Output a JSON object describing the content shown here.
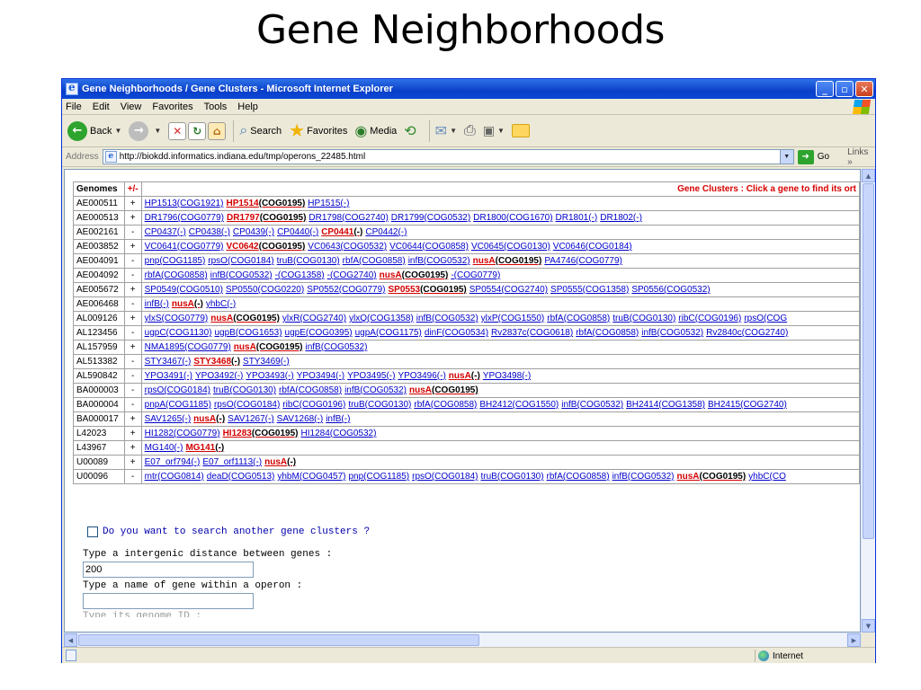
{
  "slide": {
    "title": "Gene Neighborhoods"
  },
  "browser": {
    "title": "Gene Neighborhoods / Gene Clusters - Microsoft Internet Explorer",
    "menu": [
      "File",
      "Edit",
      "View",
      "Favorites",
      "Tools",
      "Help"
    ],
    "toolbar": {
      "back": "Back",
      "search": "Search",
      "favorites": "Favorites",
      "media": "Media"
    },
    "address_label": "Address",
    "url": "http://biokdd.informatics.indiana.edu/tmp/operons_22485.html",
    "go": "Go",
    "links": "Links",
    "status_zone": "Internet"
  },
  "table": {
    "col_genomes": "Genomes",
    "col_sign": "+/-",
    "header_right": "Gene Clusters : Click a gene to find its ort",
    "rows": [
      {
        "id": "AE000511",
        "sign": "+",
        "genes": [
          {
            "t": "HP1513(COG1921)"
          },
          {
            "t": "HP1514",
            "c": "(COG0195)",
            "hit": true
          },
          {
            "t": "HP1515(-)"
          }
        ]
      },
      {
        "id": "AE000513",
        "sign": "+",
        "genes": [
          {
            "t": "DR1796(COG0779)"
          },
          {
            "t": "DR1797",
            "c": "(COG0195)",
            "hit": true
          },
          {
            "t": "DR1798(COG2740)"
          },
          {
            "t": "DR1799(COG0532)"
          },
          {
            "t": "DR1800(COG1670)"
          },
          {
            "t": "DR1801(-)"
          },
          {
            "t": "DR1802(-)"
          }
        ]
      },
      {
        "id": "AE002161",
        "sign": "-",
        "genes": [
          {
            "t": "CP0437(-)"
          },
          {
            "t": "CP0438(-)"
          },
          {
            "t": "CP0439(-)"
          },
          {
            "t": "CP0440(-)"
          },
          {
            "t": "CP0441",
            "c": "(-)",
            "hit": true
          },
          {
            "t": "CP0442(-)"
          }
        ]
      },
      {
        "id": "AE003852",
        "sign": "+",
        "genes": [
          {
            "t": "VC0641(COG0779)"
          },
          {
            "t": "VC0642",
            "c": "(COG0195)",
            "hit": true
          },
          {
            "t": "VC0643(COG0532)"
          },
          {
            "t": "VC0644(COG0858)"
          },
          {
            "t": "VC0645(COG0130)"
          },
          {
            "t": "VC0646(COG0184)"
          }
        ]
      },
      {
        "id": "AE004091",
        "sign": "-",
        "genes": [
          {
            "t": "pnp(COG1185)"
          },
          {
            "t": "rpsO(COG0184)"
          },
          {
            "t": "truB(COG0130)"
          },
          {
            "t": "rbfA(COG0858)"
          },
          {
            "t": "infB(COG0532)"
          },
          {
            "t": "nusA",
            "c": "(COG0195)",
            "hit": true
          },
          {
            "t": "PA4746(COG0779)"
          }
        ]
      },
      {
        "id": "AE004092",
        "sign": "-",
        "genes": [
          {
            "t": "rbfA(COG0858)"
          },
          {
            "t": "infB(COG0532)"
          },
          {
            "t": "-(COG1358)"
          },
          {
            "t": "-(COG2740)"
          },
          {
            "t": "nusA",
            "c": "(COG0195)",
            "hit": true
          },
          {
            "t": "-(COG0779)"
          }
        ]
      },
      {
        "id": "AE005672",
        "sign": "+",
        "genes": [
          {
            "t": "SP0549(COG0510)"
          },
          {
            "t": "SP0550(COG0220)"
          },
          {
            "t": "SP0552(COG0779)"
          },
          {
            "t": "SP0553",
            "c": "(COG0195)",
            "hit": true
          },
          {
            "t": "SP0554(COG2740)"
          },
          {
            "t": "SP0555(COG1358)"
          },
          {
            "t": "SP0556(COG0532)"
          }
        ]
      },
      {
        "id": "AE006468",
        "sign": "-",
        "genes": [
          {
            "t": "infB(-)"
          },
          {
            "t": "nusA",
            "c": "(-)",
            "hit": true
          },
          {
            "t": "yhbC(-)"
          }
        ]
      },
      {
        "id": "AL009126",
        "sign": "+",
        "genes": [
          {
            "t": "ylxS(COG0779)"
          },
          {
            "t": "nusA",
            "c": "(COG0195)",
            "hit": true
          },
          {
            "t": "ylxR(COG2740)"
          },
          {
            "t": "ylxQ(COG1358)"
          },
          {
            "t": "infB(COG0532)"
          },
          {
            "t": "ylxP(COG1550)"
          },
          {
            "t": "rbfA(COG0858)"
          },
          {
            "t": "truB(COG0130)"
          },
          {
            "t": "ribC(COG0196)"
          },
          {
            "t": "rpsO(COG"
          }
        ]
      },
      {
        "id": "AL123456",
        "sign": "-",
        "genes": [
          {
            "t": "ugpC(COG1130)"
          },
          {
            "t": "ugpB(COG1653)"
          },
          {
            "t": "ugpE(COG0395)"
          },
          {
            "t": "ugpA(COG1175)"
          },
          {
            "t": "dinF(COG0534)"
          },
          {
            "t": "Rv2837c(COG0618)"
          },
          {
            "t": "rbfA(COG0858)"
          },
          {
            "t": "infB(COG0532)"
          },
          {
            "t": "Rv2840c(COG2740)"
          }
        ]
      },
      {
        "id": "AL157959",
        "sign": "+",
        "genes": [
          {
            "t": "NMA1895(COG0779)"
          },
          {
            "t": "nusA",
            "c": "(COG0195)",
            "hit": true
          },
          {
            "t": "infB(COG0532)"
          }
        ]
      },
      {
        "id": "AL513382",
        "sign": "-",
        "genes": [
          {
            "t": "STY3467(-)"
          },
          {
            "t": "STY3468",
            "c": "(-)",
            "hit": true
          },
          {
            "t": "STY3469(-)"
          }
        ]
      },
      {
        "id": "AL590842",
        "sign": "-",
        "genes": [
          {
            "t": "YPO3491(-)"
          },
          {
            "t": "YPO3492(-)"
          },
          {
            "t": "YPO3493(-)"
          },
          {
            "t": "YPO3494(-)"
          },
          {
            "t": "YPO3495(-)"
          },
          {
            "t": "YPO3496(-)"
          },
          {
            "t": "nusA",
            "c": "(-)",
            "hit": true
          },
          {
            "t": "YPO3498(-)"
          }
        ]
      },
      {
        "id": "BA000003",
        "sign": "-",
        "genes": [
          {
            "t": "rpsO(COG0184)"
          },
          {
            "t": "truB(COG0130)"
          },
          {
            "t": "rbfA(COG0858)"
          },
          {
            "t": "infB(COG0532)"
          },
          {
            "t": "nusA",
            "c": "(COG0195)",
            "hit": true
          }
        ]
      },
      {
        "id": "BA000004",
        "sign": "-",
        "genes": [
          {
            "t": "pnpA(COG1185)"
          },
          {
            "t": "rpsO(COG0184)"
          },
          {
            "t": "ribC(COG0196)"
          },
          {
            "t": "truB(COG0130)"
          },
          {
            "t": "rbfA(COG0858)"
          },
          {
            "t": "BH2412(COG1550)"
          },
          {
            "t": "infB(COG0532)"
          },
          {
            "t": "BH2414(COG1358)"
          },
          {
            "t": "BH2415(COG2740)"
          }
        ]
      },
      {
        "id": "BA000017",
        "sign": "+",
        "genes": [
          {
            "t": "SAV1265(-)"
          },
          {
            "t": "nusA",
            "c": "(-)",
            "hit": true
          },
          {
            "t": "SAV1267(-)"
          },
          {
            "t": "SAV1268(-)"
          },
          {
            "t": "infB(-)"
          }
        ]
      },
      {
        "id": "L42023",
        "sign": "+",
        "genes": [
          {
            "t": "HI1282(COG0779)"
          },
          {
            "t": "HI1283",
            "c": "(COG0195)",
            "hit": true
          },
          {
            "t": "HI1284(COG0532)"
          }
        ]
      },
      {
        "id": "L43967",
        "sign": "+",
        "genes": [
          {
            "t": "MG140(-)"
          },
          {
            "t": "MG141",
            "c": "(-)",
            "hit": true
          }
        ]
      },
      {
        "id": "U00089",
        "sign": "+",
        "genes": [
          {
            "t": "E07_orf794(-)"
          },
          {
            "t": "E07_orf1113(-)"
          },
          {
            "t": "nusA",
            "c": "(-)",
            "hit": true
          }
        ]
      },
      {
        "id": "U00096",
        "sign": "-",
        "genes": [
          {
            "t": "mtr(COG0814)"
          },
          {
            "t": "deaD(COG0513)"
          },
          {
            "t": "yhbM(COG0457)"
          },
          {
            "t": "pnp(COG1185)"
          },
          {
            "t": "rpsO(COG0184)"
          },
          {
            "t": "truB(COG0130)"
          },
          {
            "t": "rbfA(COG0858)"
          },
          {
            "t": "infB(COG0532)"
          },
          {
            "t": "nusA",
            "c": "(COG0195)",
            "hit": true
          },
          {
            "t": "yhbC(CO"
          }
        ]
      }
    ]
  },
  "form": {
    "search_again": "Do you want to search another gene clusters ?",
    "distance_label": "Type a intergenic distance between genes :",
    "distance_value": "200",
    "gene_label": "Type a name of gene within a operon :",
    "gene_value": "",
    "genome_label_cut": "Type its genome ID :"
  },
  "colors": {
    "hit": "#d40000",
    "link": "#0000cc",
    "titlebar": "#0a3fc8"
  }
}
